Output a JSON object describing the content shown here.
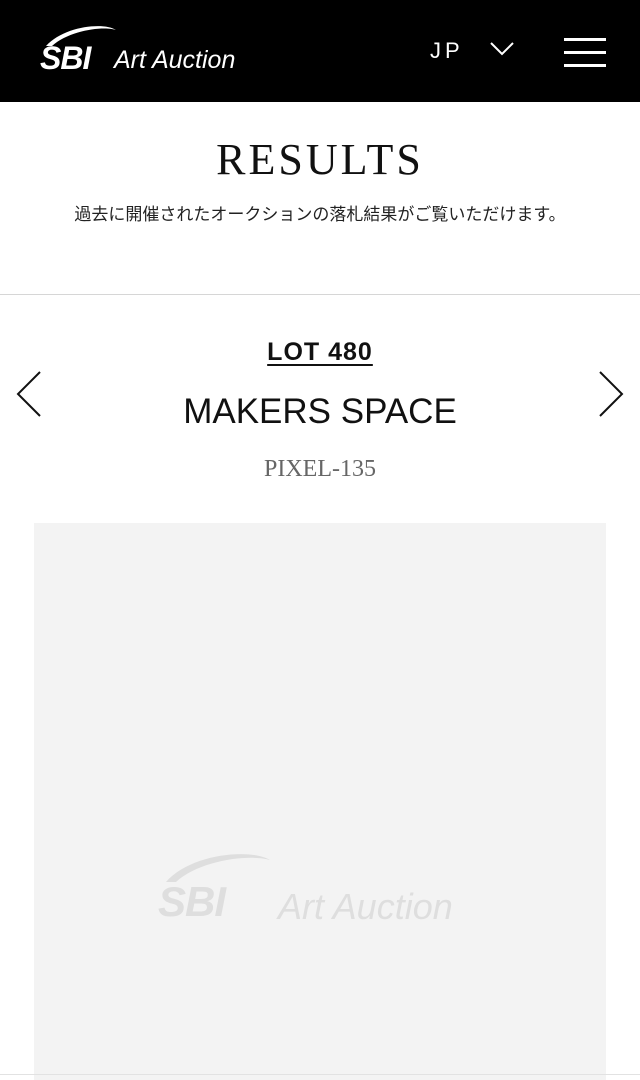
{
  "header": {
    "logo": {
      "brand": "SBI",
      "name": "Art Auction"
    },
    "language": "JP",
    "icons": {
      "language_dropdown": "chevron-down-icon",
      "menu": "hamburger-menu-icon"
    },
    "background_color": "#000000"
  },
  "results": {
    "title": "RESULTS",
    "description": "過去に開催されたオークションの落札結果がご覧いただけます。"
  },
  "lot": {
    "number_label": "LOT 480",
    "title": "MAKERS SPACE",
    "subtitle": "PIXEL-135",
    "prev_icon": "chevron-left-icon",
    "next_icon": "chevron-right-icon"
  },
  "image": {
    "placeholder_brand": "SBI",
    "placeholder_name": "Art Auction",
    "background_color": "#f3f3f3"
  }
}
